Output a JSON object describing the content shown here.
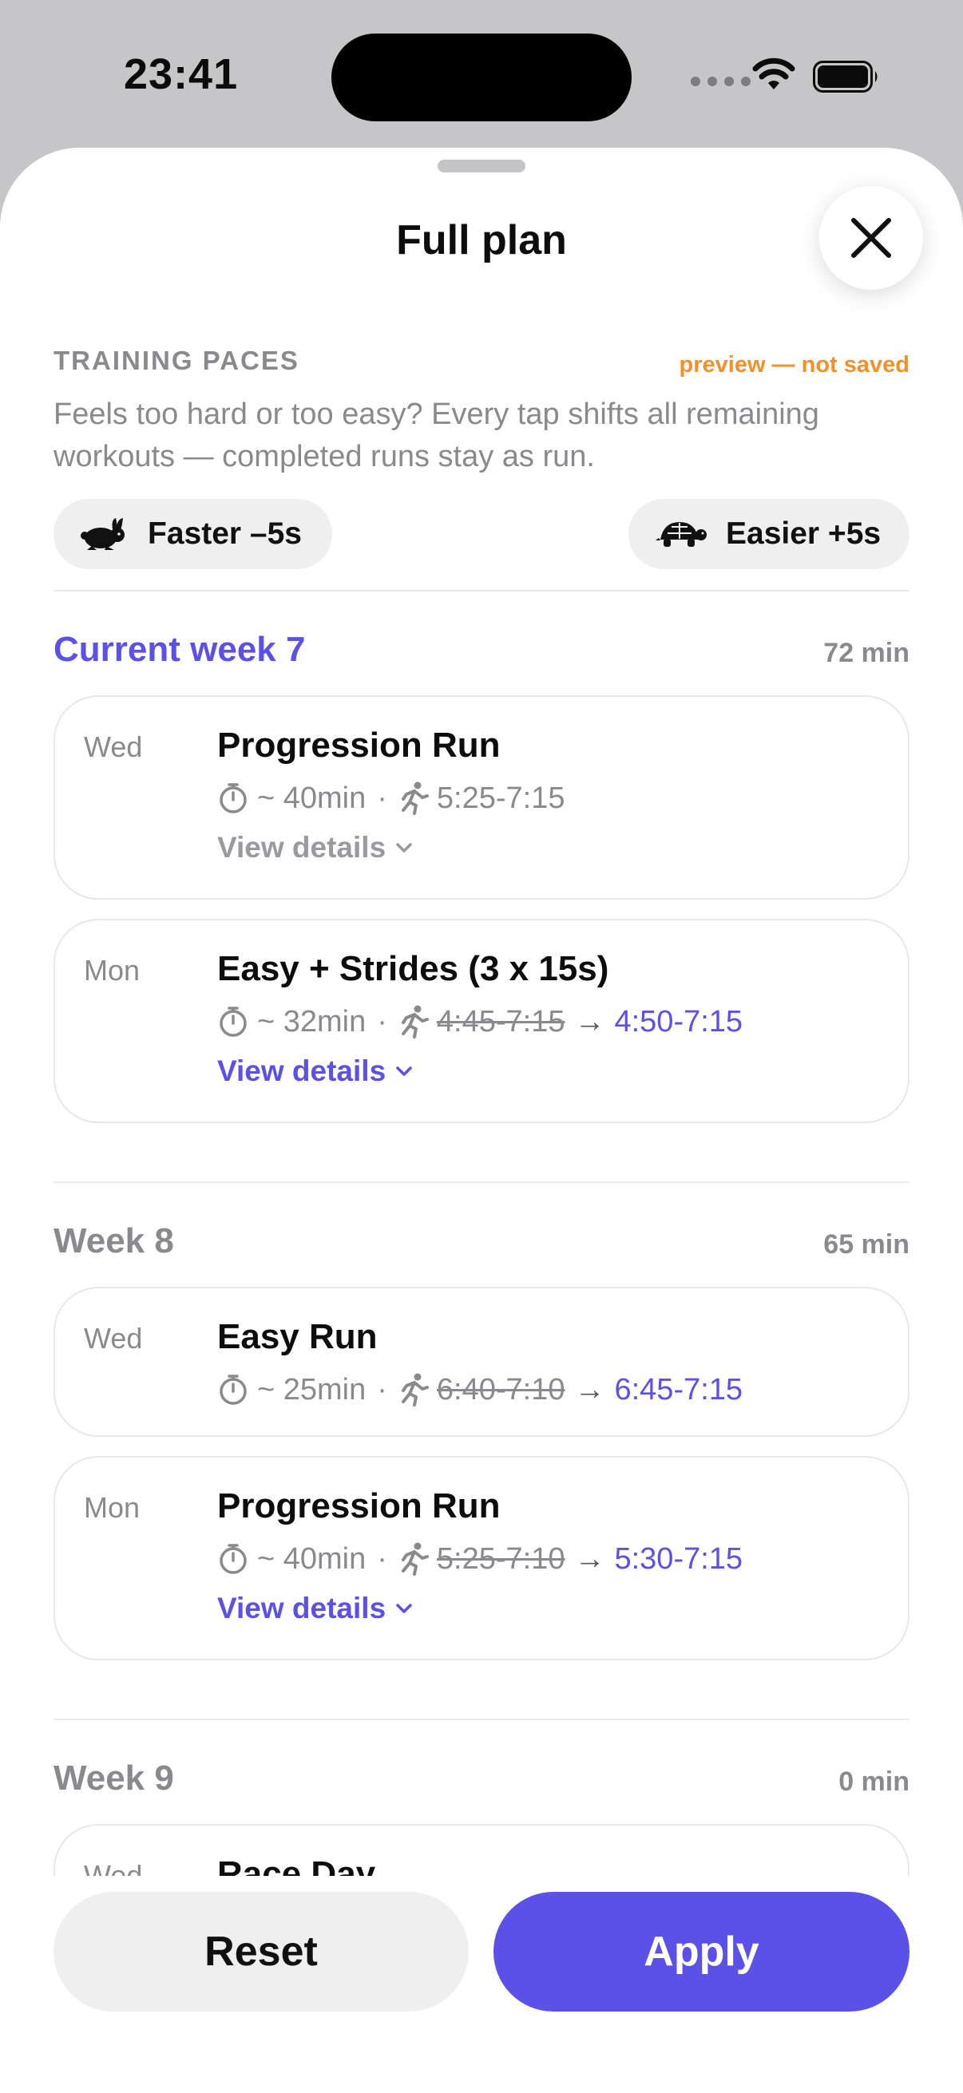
{
  "status_bar": {
    "time": "23:41"
  },
  "sheet": {
    "title": "Full plan"
  },
  "training_paces": {
    "heading": "TRAINING PACES",
    "preview_note": "preview — not saved",
    "description": "Feels too hard or too easy? Every tap shifts all remaining workouts — completed runs stay as run.",
    "faster_label": "Faster –5s",
    "easier_label": "Easier +5s"
  },
  "weeks": [
    {
      "title": "Current week 7",
      "total": "72 min",
      "workouts": [
        {
          "day": "Wed",
          "name": "Progression Run",
          "duration": "~ 40min",
          "pace": "5:25-7:15",
          "details": "View details"
        },
        {
          "day": "Mon",
          "name": "Easy + Strides (3 x 15s)",
          "duration": "~ 32min",
          "old_pace": "4:45-7:15",
          "new_pace": "4:50-7:15",
          "details": "View details"
        }
      ]
    },
    {
      "title": "Week 8",
      "total": "65 min",
      "workouts": [
        {
          "day": "Wed",
          "name": "Easy Run",
          "duration": "~ 25min",
          "old_pace": "6:40-7:10",
          "new_pace": "6:45-7:15"
        },
        {
          "day": "Mon",
          "name": "Progression Run",
          "duration": "~ 40min",
          "old_pace": "5:25-7:10",
          "new_pace": "5:30-7:15",
          "details": "View details"
        }
      ]
    },
    {
      "title": "Week 9",
      "total": "0 min",
      "workouts": [
        {
          "day": "Wed",
          "name": "Race Day"
        }
      ]
    }
  ],
  "buttons": {
    "reset": "Reset",
    "apply": "Apply"
  },
  "colors": {
    "accent": "#5b50e8",
    "preview": "#f4902a",
    "muted": "#8a8a8e"
  }
}
